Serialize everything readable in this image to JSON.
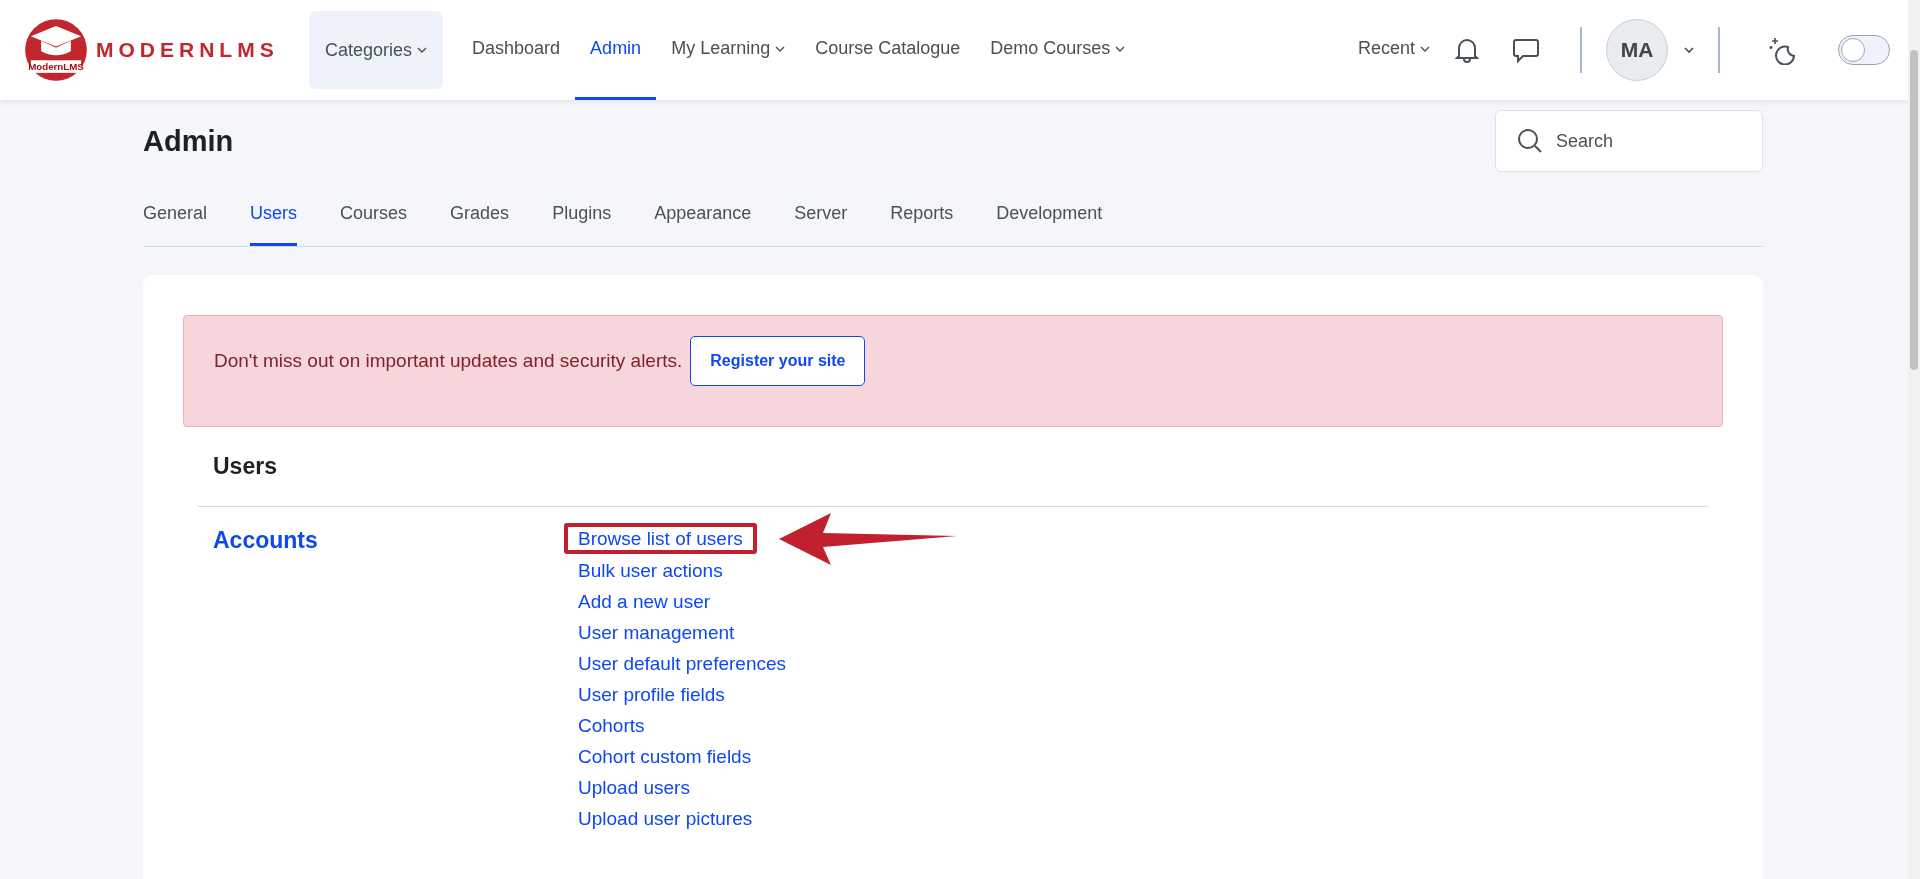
{
  "brand": {
    "name": "MODERNLMS",
    "badge_text": "ModernLMS"
  },
  "nav": [
    {
      "label": "Categories",
      "dropdown": true,
      "selected": false,
      "boxed": true
    },
    {
      "label": "Dashboard",
      "dropdown": false,
      "selected": false,
      "boxed": false
    },
    {
      "label": "Admin",
      "dropdown": false,
      "selected": true,
      "boxed": false
    },
    {
      "label": "My Learning",
      "dropdown": true,
      "selected": false,
      "boxed": false
    },
    {
      "label": "Course Catalogue",
      "dropdown": false,
      "selected": false,
      "boxed": false
    },
    {
      "label": "Demo Courses",
      "dropdown": true,
      "selected": false,
      "boxed": false
    }
  ],
  "recent": {
    "label": "Recent"
  },
  "user": {
    "initials": "MA"
  },
  "theme_switch": {
    "on": false
  },
  "page_title": "Admin",
  "search": {
    "placeholder": "Search"
  },
  "tabs": [
    {
      "label": "General",
      "selected": false
    },
    {
      "label": "Users",
      "selected": true
    },
    {
      "label": "Courses",
      "selected": false
    },
    {
      "label": "Grades",
      "selected": false
    },
    {
      "label": "Plugins",
      "selected": false
    },
    {
      "label": "Appearance",
      "selected": false
    },
    {
      "label": "Server",
      "selected": false
    },
    {
      "label": "Reports",
      "selected": false
    },
    {
      "label": "Development",
      "selected": false
    }
  ],
  "alert": {
    "message": "Don't miss out on important updates and security alerts.",
    "button": "Register your site"
  },
  "section_title": "Users",
  "category": {
    "title": "Accounts",
    "links": [
      {
        "label": "Browse list of users",
        "highlighted": true
      },
      {
        "label": "Bulk user actions",
        "highlighted": false
      },
      {
        "label": "Add a new user",
        "highlighted": false
      },
      {
        "label": "User management",
        "highlighted": false
      },
      {
        "label": "User default preferences",
        "highlighted": false
      },
      {
        "label": "User profile fields",
        "highlighted": false
      },
      {
        "label": "Cohorts",
        "highlighted": false
      },
      {
        "label": "Cohort custom fields",
        "highlighted": false
      },
      {
        "label": "Upload users",
        "highlighted": false
      },
      {
        "label": "Upload user pictures",
        "highlighted": false
      }
    ]
  }
}
